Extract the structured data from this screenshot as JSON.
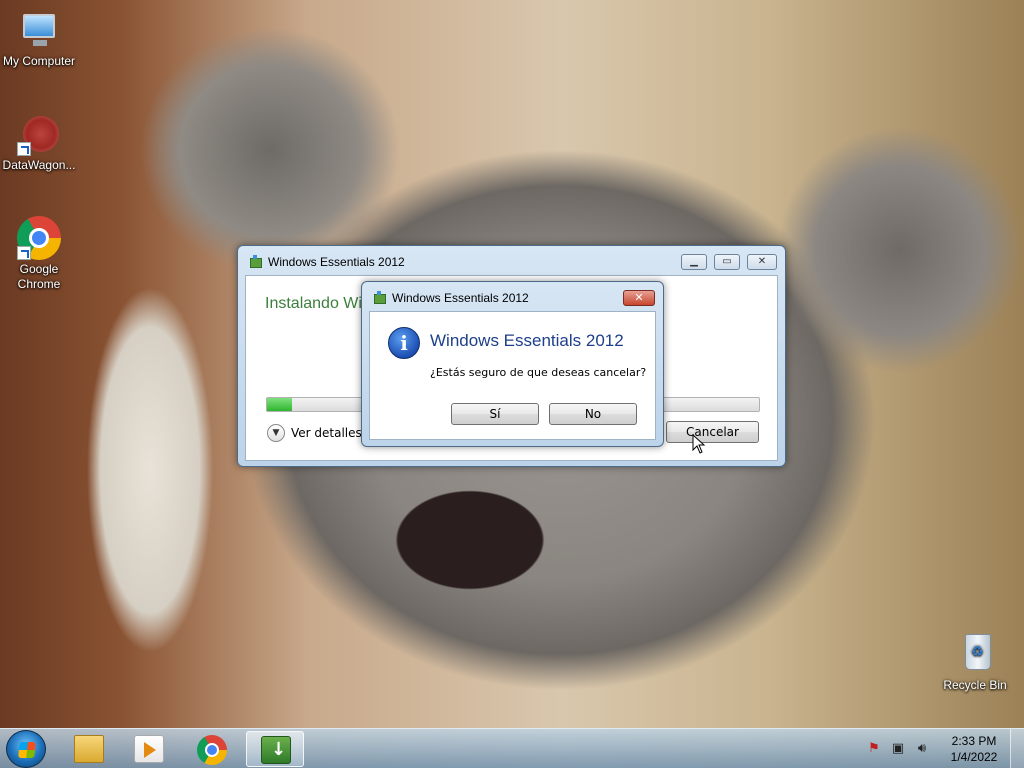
{
  "desktop": {
    "icons": [
      {
        "label": "My Computer",
        "icon": "computer-icon"
      },
      {
        "label": "DataWagon...",
        "icon": "datawagon-icon"
      },
      {
        "label": "Google Chrome",
        "icon": "chrome-icon"
      },
      {
        "label": "Recycle Bin",
        "icon": "recycle-bin-icon"
      }
    ]
  },
  "installer_window": {
    "title": "Windows Essentials 2012",
    "heading": "Instalando Wi",
    "progress": 0.05,
    "details_label": "Ver detalles",
    "cancel_label": "Cancelar",
    "accent_color": "#3c7f3c"
  },
  "dialog": {
    "title": "Windows Essentials 2012",
    "heading": "Windows Essentials 2012",
    "message": "¿Estás seguro de que deseas cancelar?",
    "yes_label": "Sí",
    "no_label": "No",
    "icon": "info-icon",
    "heading_color": "#1e3f8a"
  },
  "taskbar": {
    "items": [
      "explorer-icon",
      "media-player-icon",
      "chrome-icon",
      "installer-icon"
    ],
    "active_item": "installer-icon",
    "tray_icons": [
      "action-center-icon",
      "network-icon",
      "volume-icon"
    ],
    "time": "2:33 PM",
    "date": "1/4/2022"
  }
}
